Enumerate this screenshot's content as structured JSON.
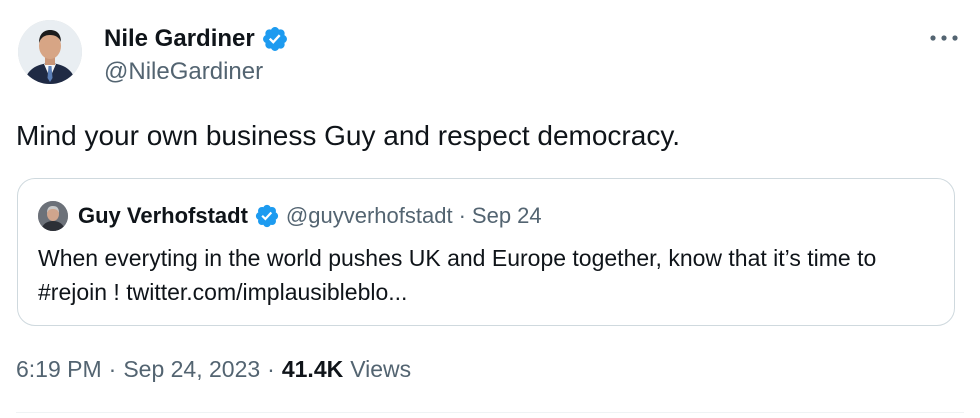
{
  "author": {
    "name": "Nile Gardiner",
    "handle": "@NileGardiner",
    "verified": true,
    "avatar_icon": "profile-photo-man-suit"
  },
  "tweet": {
    "text": "Mind your own business Guy and respect democracy."
  },
  "quoted_tweet": {
    "author_name": "Guy Verhofstadt",
    "handle": "@guyverhofstadt",
    "separator": "·",
    "date": "Sep 24",
    "verified": true,
    "avatar_icon": "profile-photo-man",
    "text": "When everyting in the world pushes UK and Europe together, know that it’s time to #rejoin ! twitter.com/implausibleblo..."
  },
  "meta": {
    "time": "6:19 PM",
    "separator1": "·",
    "date": "Sep 24, 2023",
    "separator2": "·",
    "views_count": "41.4K",
    "views_label": "Views"
  },
  "icons": {
    "more": "more-horizontal-icon",
    "verified": "verified-badge-icon"
  },
  "colors": {
    "verified_blue": "#1d9bf0",
    "text_primary": "#0f1419",
    "text_secondary": "#536471",
    "border": "#cfd9de"
  }
}
